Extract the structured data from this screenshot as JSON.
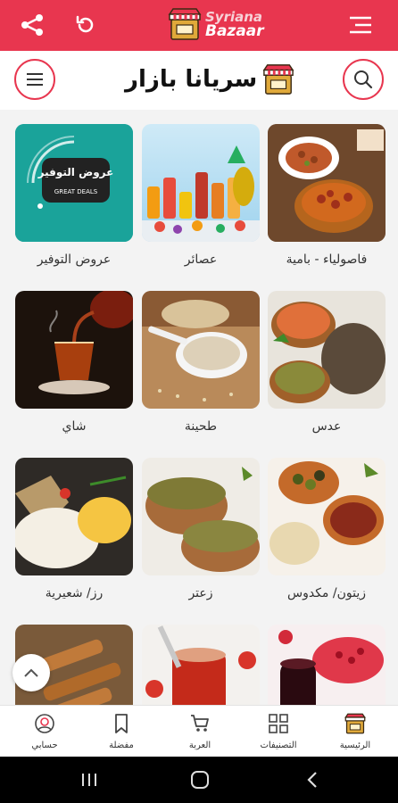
{
  "app": {
    "logo_line1": "Syriana",
    "logo_line2": "Bazaar",
    "brand_name": "سريانا بازار",
    "accent_color": "#e8364f"
  },
  "categories": [
    {
      "label": "عروض التوفير",
      "image": "save-offers-badge",
      "badge_title": "عروض التوفير",
      "badge_sub": "GREAT DEALS"
    },
    {
      "label": "عصائر",
      "image": "juices-photo"
    },
    {
      "label": "فاصولياء - بامية",
      "image": "beans-okra-photo"
    },
    {
      "label": "شاي",
      "image": "tea-photo"
    },
    {
      "label": "طحينة",
      "image": "tahini-photo"
    },
    {
      "label": "عدس",
      "image": "lentils-photo"
    },
    {
      "label": "رز/ شعيرية",
      "image": "rice-vermicelli-photo"
    },
    {
      "label": "زعتر",
      "image": "zaatar-photo"
    },
    {
      "label": "زيتون/ مكدوس",
      "image": "olives-makdous-photo"
    },
    {
      "label": "",
      "image": "sweets-photo"
    },
    {
      "label": "",
      "image": "tomato-paste-photo"
    },
    {
      "label": "",
      "image": "pomegranate-molasses-photo"
    }
  ],
  "bottom_nav": [
    {
      "label": "الرئيسية",
      "icon": "home-store-icon"
    },
    {
      "label": "التصنيفات",
      "icon": "categories-icon"
    },
    {
      "label": "العربة",
      "icon": "cart-icon"
    },
    {
      "label": "مفضلة",
      "icon": "bookmark-icon"
    },
    {
      "label": "حسابي",
      "icon": "account-icon"
    }
  ]
}
